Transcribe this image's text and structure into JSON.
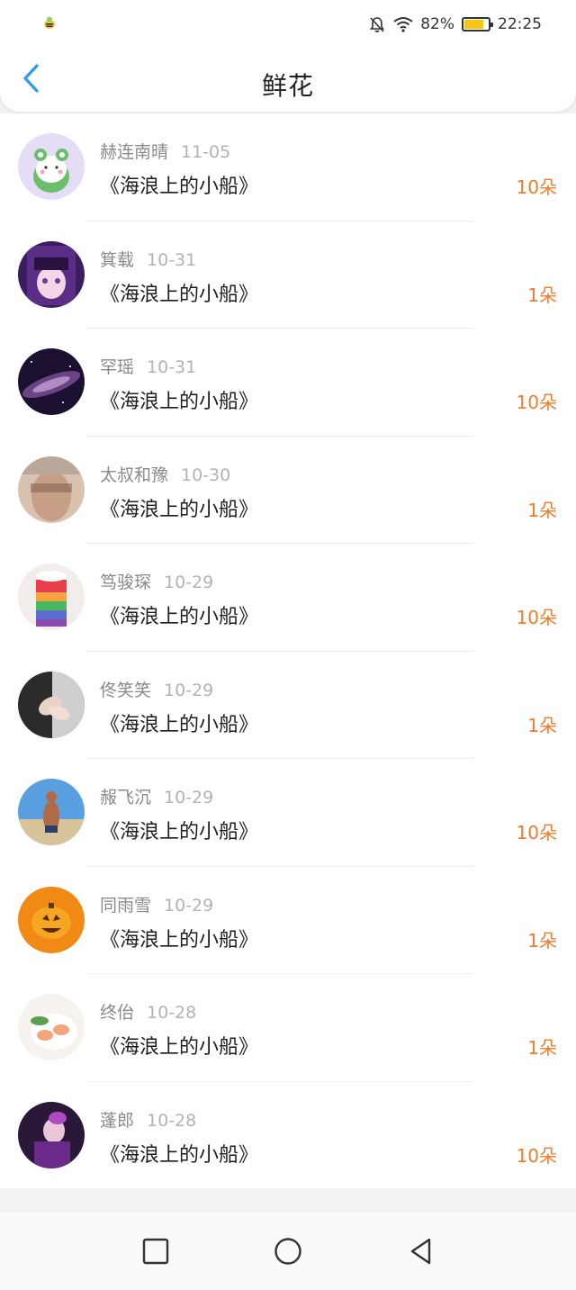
{
  "status_bar": {
    "left_icon": "bee-notification-icon",
    "battery_percent": "82%",
    "battery_level": 0.82,
    "time": "22:25",
    "icons": [
      "bell-muted-icon",
      "wifi-icon",
      "battery-icon"
    ]
  },
  "header": {
    "back_icon": "chevron-left-icon",
    "title": "鲜花"
  },
  "list": [
    {
      "name": "赫连南晴",
      "date": "11-05",
      "title": "《海浪上的小船》",
      "count": "10朵",
      "avatar": "frog-avatar"
    },
    {
      "name": "箕载",
      "date": "10-31",
      "title": "《海浪上的小船》",
      "count": "1朵",
      "avatar": "anime-girl-avatar"
    },
    {
      "name": "罕瑶",
      "date": "10-31",
      "title": "《海浪上的小船》",
      "count": "10朵",
      "avatar": "galaxy-avatar"
    },
    {
      "name": "太叔和豫",
      "date": "10-30",
      "title": "《海浪上的小船》",
      "count": "1朵",
      "avatar": "photo-avatar"
    },
    {
      "name": "笃骏琛",
      "date": "10-29",
      "title": "《海浪上的小船》",
      "count": "10朵",
      "avatar": "rainbow-drink-avatar"
    },
    {
      "name": "佟笑笑",
      "date": "10-29",
      "title": "《海浪上的小船》",
      "count": "1朵",
      "avatar": "hands-avatar"
    },
    {
      "name": "赧飞沉",
      "date": "10-29",
      "title": "《海浪上的小船》",
      "count": "10朵",
      "avatar": "beach-man-avatar"
    },
    {
      "name": "同雨雪",
      "date": "10-29",
      "title": "《海浪上的小船》",
      "count": "1朵",
      "avatar": "pumpkin-avatar"
    },
    {
      "name": "终佁",
      "date": "10-28",
      "title": "《海浪上的小船》",
      "count": "1朵",
      "avatar": "food-avatar"
    },
    {
      "name": "蓬郎",
      "date": "10-28",
      "title": "《海浪上的小船》",
      "count": "10朵",
      "avatar": "purple-portrait-avatar"
    }
  ],
  "colors": {
    "accent_blue": "#2e9bf0",
    "count_orange": "#f07c2c",
    "name_gray": "#8a8a8a",
    "date_gray": "#b3b3b3"
  },
  "nav_bar": {
    "icons": [
      "square-recent-icon",
      "circle-home-icon",
      "triangle-back-icon"
    ]
  }
}
